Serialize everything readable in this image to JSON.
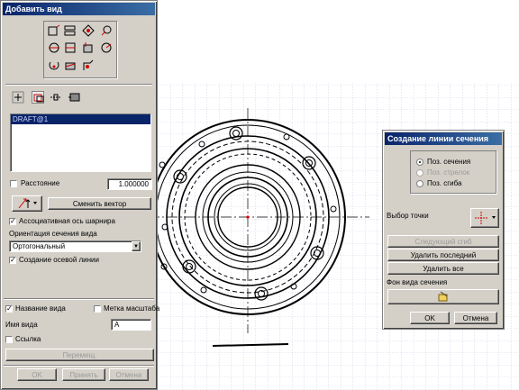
{
  "add_view_panel": {
    "title": "Добавить вид",
    "list_item": "DRAFT@1",
    "distance_label": "Расстояние",
    "distance_value": "1.000000",
    "change_vector_button": "Сменить вектор",
    "associative_axis_label": "Ассоциативная ось шарнира",
    "orientation_label": "Ориентация сечения вида",
    "orientation_value": "Ортогональный",
    "axis_line_label": "Создание осевой линии",
    "view_name_check_label": "Название вида",
    "scale_label_check": "Метка масштаба",
    "view_name_label": "Имя вида",
    "view_name_value": "A",
    "link_label": "Ссылка",
    "move_button": "Перемещ.",
    "ok_button": "OK",
    "apply_button": "Принять",
    "cancel_button": "Отмена",
    "checks": {
      "distance": false,
      "associative_axis": true,
      "axis_line": true,
      "view_name": true,
      "scale_label": false,
      "link": false
    }
  },
  "section_dialog": {
    "title": "Создание линии сечения",
    "radio_section_pos": "Поз. сечения",
    "radio_arrow_pos": "Поз. стрелок",
    "radio_bend_pos": "Поз. сгиба",
    "selected_radio": "section_pos",
    "point_select_label": "Выбор точки",
    "next_bend_button": "Следующий сгиб",
    "delete_last_button": "Удалить последний",
    "delete_all_button": "Удалить все",
    "background_label": "Фон вида сечения",
    "ok_button": "OK",
    "cancel_button": "Отмена"
  },
  "colors": {
    "title_start": "#0a246a",
    "title_end": "#3a6ea5",
    "panel": "#d4d0c8",
    "selection": "#0a246a",
    "grid": "#a8b4d8"
  },
  "icons": [
    "view-type-icons",
    "center-axis-icon",
    "section-line-icon",
    "crosshair-icon",
    "background-paint-icon",
    "dropdown-arrow-icon"
  ]
}
